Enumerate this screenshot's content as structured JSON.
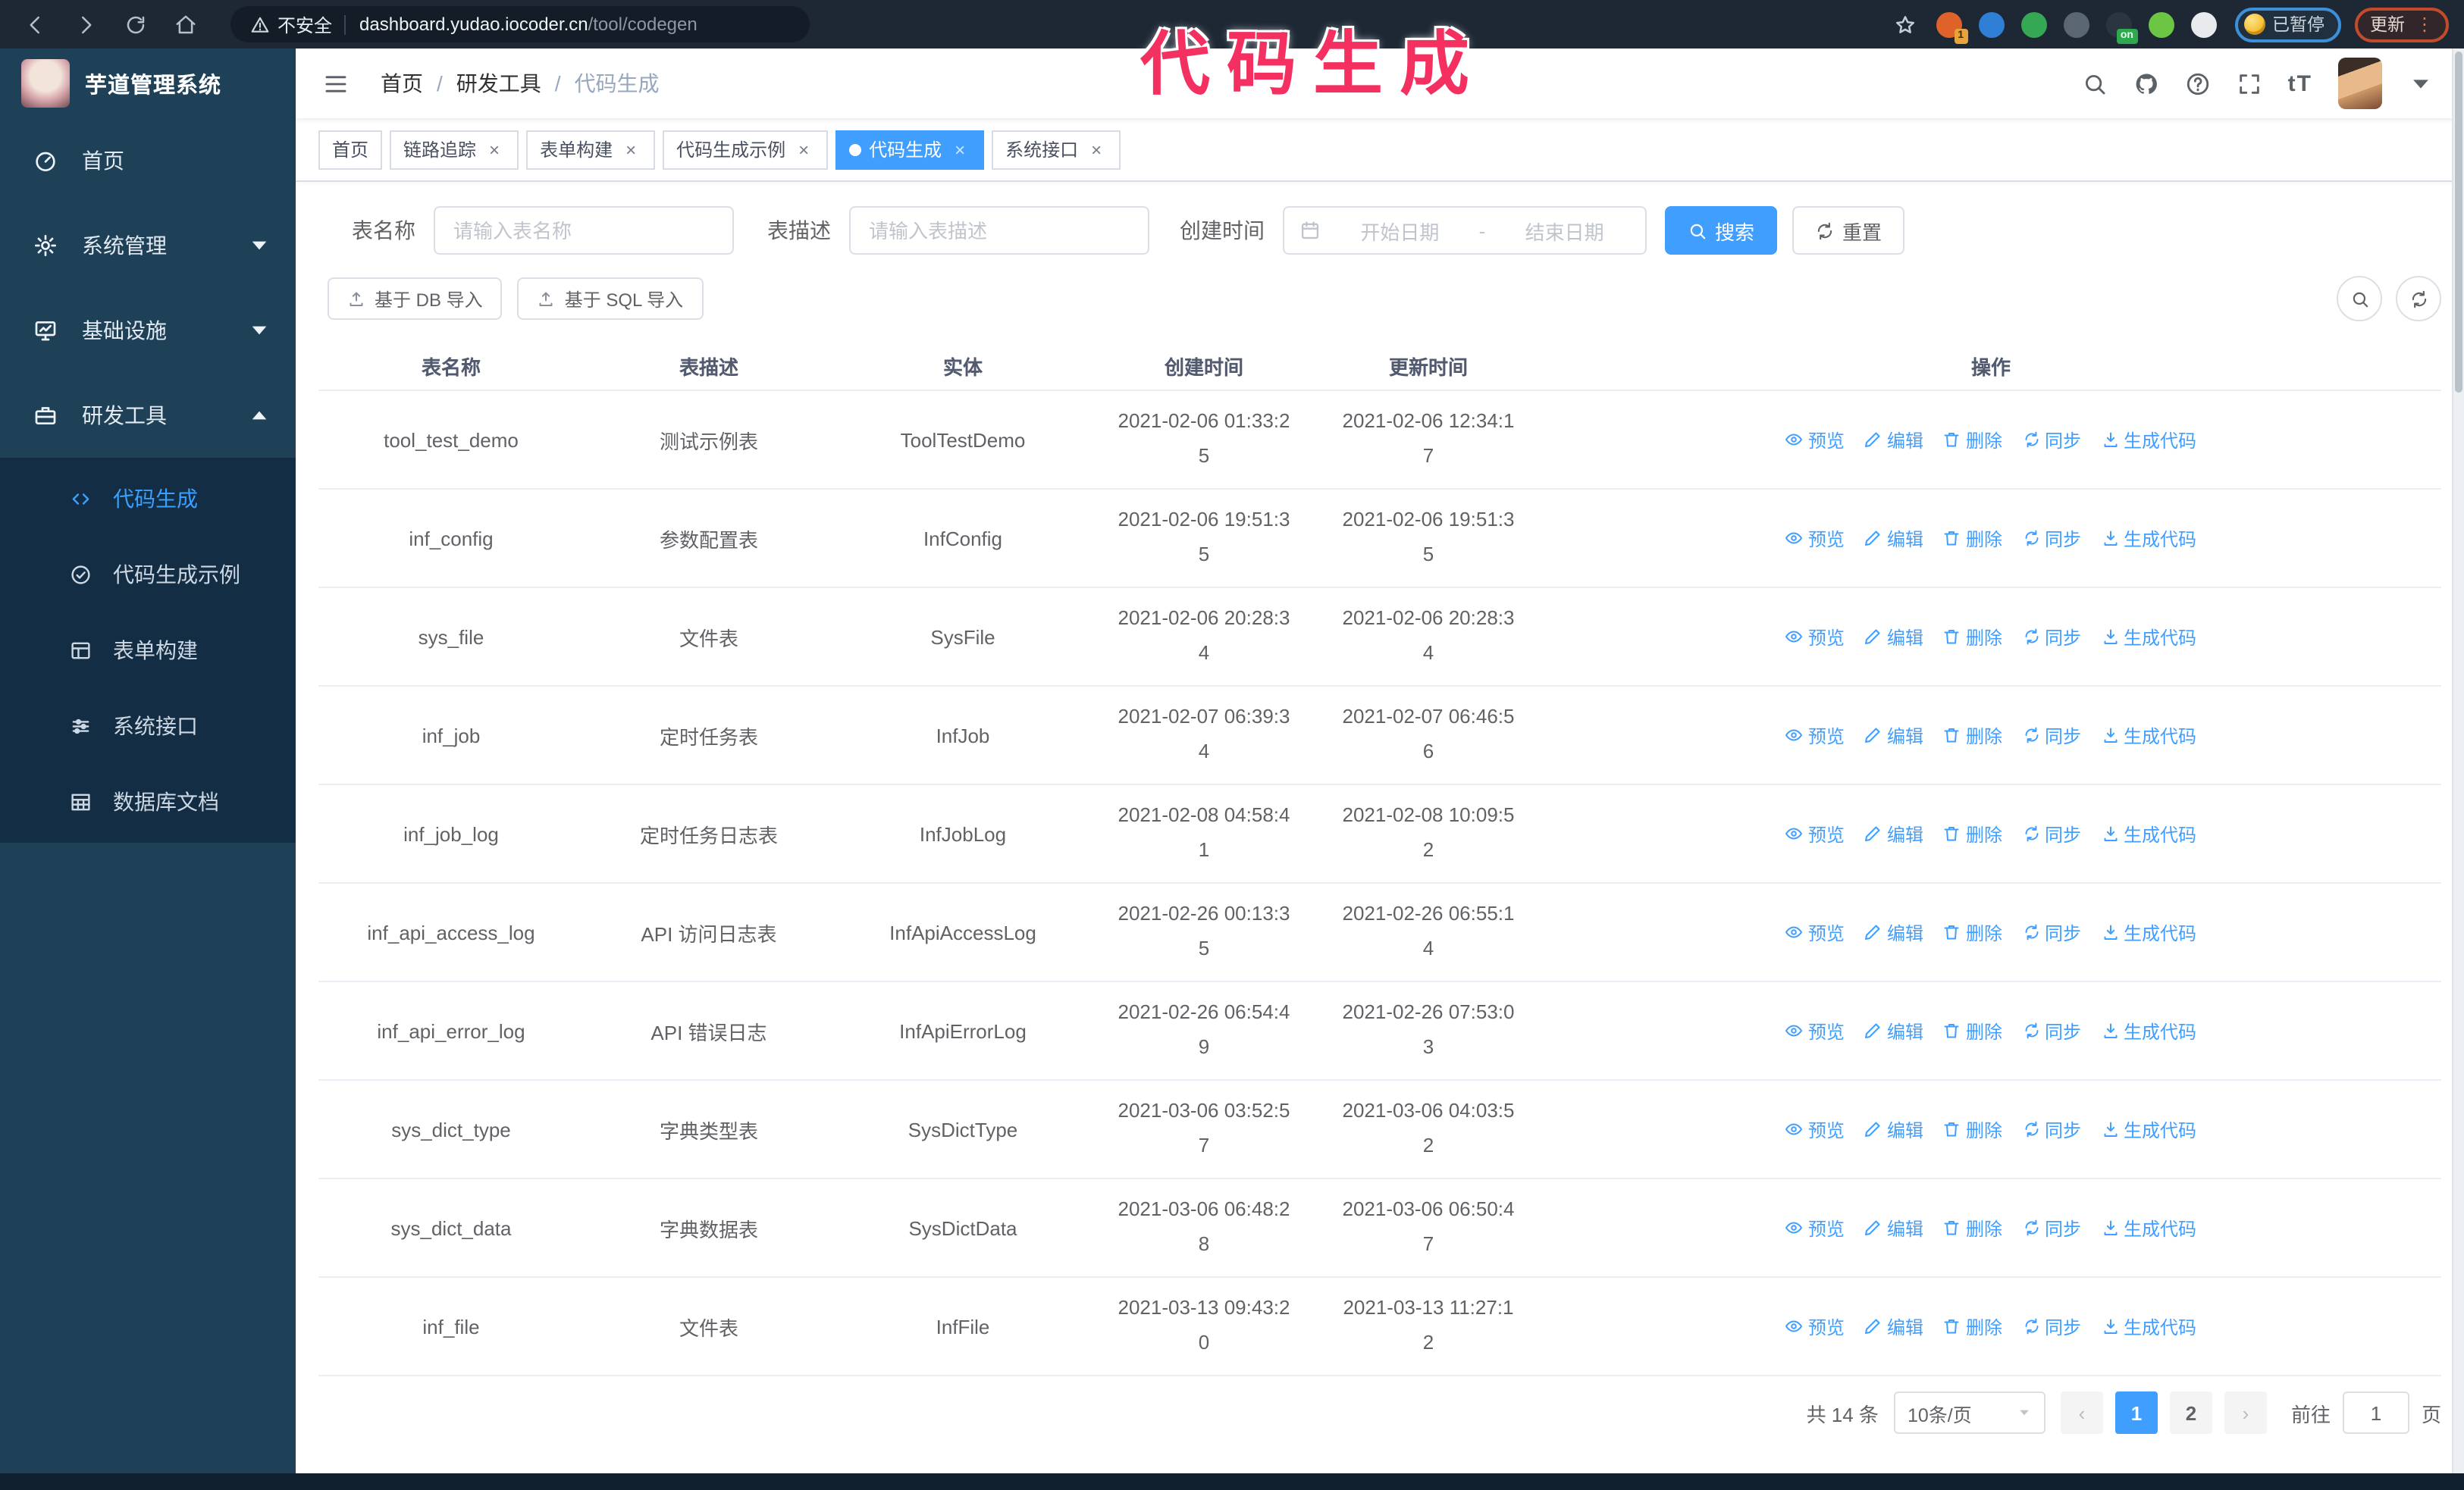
{
  "browser": {
    "security_warning": "不安全",
    "url_host": "dashboard.yudao.iocoder.cn",
    "url_path": "/tool/codegen",
    "paused_badge": "已暂停",
    "update_button": "更新",
    "extensions": [
      {
        "name": "extension-icon-1",
        "color": "#e0622b",
        "badge": "1"
      },
      {
        "name": "extension-icon-2",
        "color": "#2f7fd6",
        "badge": ""
      },
      {
        "name": "extension-icon-3",
        "color": "#35a854",
        "badge": ""
      },
      {
        "name": "extension-icon-4",
        "color": "#5b6770",
        "badge": ""
      },
      {
        "name": "extension-icon-5",
        "color": "#2b3540",
        "badge": "on"
      },
      {
        "name": "extension-icon-6",
        "color": "#6cc644",
        "badge": ""
      },
      {
        "name": "extension-icon-7",
        "color": "#e8eaed",
        "badge": ""
      }
    ]
  },
  "annotation": {
    "title": "代码生成"
  },
  "sidebar": {
    "app_title": "芋道管理系统",
    "items": [
      {
        "label": "首页",
        "icon": "dashboard",
        "chevron": "",
        "active": false,
        "children": []
      },
      {
        "label": "系统管理",
        "icon": "gear",
        "chevron": "down",
        "active": false,
        "children": []
      },
      {
        "label": "基础设施",
        "icon": "monitor",
        "chevron": "down",
        "active": false,
        "children": []
      },
      {
        "label": "研发工具",
        "icon": "toolbox",
        "chevron": "up",
        "active": false,
        "children": [
          {
            "label": "代码生成",
            "icon": "code",
            "active": true
          },
          {
            "label": "代码生成示例",
            "icon": "circle-check",
            "active": false
          },
          {
            "label": "表单构建",
            "icon": "form",
            "active": false
          },
          {
            "label": "系统接口",
            "icon": "sliders",
            "active": false
          },
          {
            "label": "数据库文档",
            "icon": "grid",
            "active": false
          }
        ]
      }
    ]
  },
  "breadcrumb": [
    "首页",
    "研发工具",
    "代码生成"
  ],
  "tabs": [
    {
      "label": "首页",
      "closable": false,
      "active": false
    },
    {
      "label": "链路追踪",
      "closable": true,
      "active": false
    },
    {
      "label": "表单构建",
      "closable": true,
      "active": false
    },
    {
      "label": "代码生成示例",
      "closable": true,
      "active": false
    },
    {
      "label": "代码生成",
      "closable": true,
      "active": true
    },
    {
      "label": "系统接口",
      "closable": true,
      "active": false
    }
  ],
  "search_form": {
    "table_name_label": "表名称",
    "table_name_placeholder": "请输入表名称",
    "table_desc_label": "表描述",
    "table_desc_placeholder": "请输入表描述",
    "create_time_label": "创建时间",
    "date_start_placeholder": "开始日期",
    "date_separator": "-",
    "date_end_placeholder": "结束日期",
    "search_button": "搜索",
    "reset_button": "重置"
  },
  "toolbar": {
    "import_db_button": "基于 DB 导入",
    "import_sql_button": "基于 SQL 导入"
  },
  "table": {
    "columns": [
      "表名称",
      "表描述",
      "实体",
      "创建时间",
      "更新时间",
      "操作"
    ],
    "actions": [
      {
        "label": "预览",
        "icon": "eye"
      },
      {
        "label": "编辑",
        "icon": "edit"
      },
      {
        "label": "删除",
        "icon": "delete"
      },
      {
        "label": "同步",
        "icon": "sync"
      },
      {
        "label": "生成代码",
        "icon": "download"
      }
    ],
    "rows": [
      {
        "name": "tool_test_demo",
        "desc": "测试示例表",
        "entity": "ToolTestDemo",
        "create_time": "2021-02-06 01:33:25",
        "update_time": "2021-02-06 12:34:17"
      },
      {
        "name": "inf_config",
        "desc": "参数配置表",
        "entity": "InfConfig",
        "create_time": "2021-02-06 19:51:35",
        "update_time": "2021-02-06 19:51:35"
      },
      {
        "name": "sys_file",
        "desc": "文件表",
        "entity": "SysFile",
        "create_time": "2021-02-06 20:28:34",
        "update_time": "2021-02-06 20:28:34"
      },
      {
        "name": "inf_job",
        "desc": "定时任务表",
        "entity": "InfJob",
        "create_time": "2021-02-07 06:39:34",
        "update_time": "2021-02-07 06:46:56"
      },
      {
        "name": "inf_job_log",
        "desc": "定时任务日志表",
        "entity": "InfJobLog",
        "create_time": "2021-02-08 04:58:41",
        "update_time": "2021-02-08 10:09:52"
      },
      {
        "name": "inf_api_access_log",
        "desc": "API 访问日志表",
        "entity": "InfApiAccessLog",
        "create_time": "2021-02-26 00:13:35",
        "update_time": "2021-02-26 06:55:14"
      },
      {
        "name": "inf_api_error_log",
        "desc": "API 错误日志",
        "entity": "InfApiErrorLog",
        "create_time": "2021-02-26 06:54:49",
        "update_time": "2021-02-26 07:53:03"
      },
      {
        "name": "sys_dict_type",
        "desc": "字典类型表",
        "entity": "SysDictType",
        "create_time": "2021-03-06 03:52:57",
        "update_time": "2021-03-06 04:03:52"
      },
      {
        "name": "sys_dict_data",
        "desc": "字典数据表",
        "entity": "SysDictData",
        "create_time": "2021-03-06 06:48:28",
        "update_time": "2021-03-06 06:50:47"
      },
      {
        "name": "inf_file",
        "desc": "文件表",
        "entity": "InfFile",
        "create_time": "2021-03-13 09:43:20",
        "update_time": "2021-03-13 11:27:12"
      }
    ]
  },
  "pagination": {
    "total_text": "共 14 条",
    "page_size": "10条/页",
    "pages": [
      "1",
      "2"
    ],
    "active_page": "1",
    "goto_label": "前往",
    "goto_value": "1",
    "goto_suffix": "页"
  },
  "colors": {
    "accent": "#409eff",
    "annotation_pink": "#f3305f",
    "sidebar_bg": "#1e4158",
    "submenu_bg": "#132d45",
    "browser_bar_bg": "#1d2834"
  }
}
